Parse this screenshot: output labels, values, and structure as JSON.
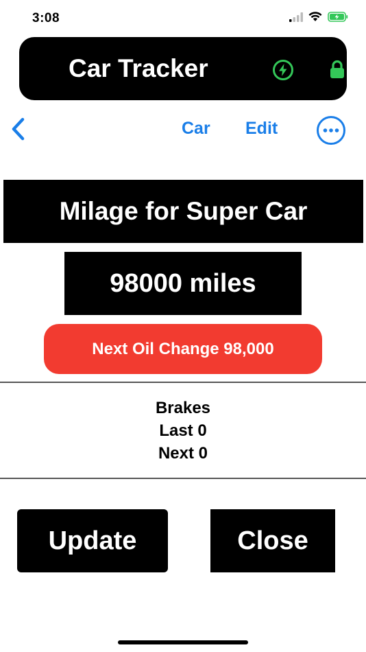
{
  "status_bar": {
    "time": "3:08"
  },
  "app": {
    "title": "Car Tracker"
  },
  "nav": {
    "car_label": "Car",
    "edit_label": "Edit"
  },
  "mileage": {
    "title": "Milage for Super Car",
    "value": "98000 miles",
    "next_oil_change": "Next Oil Change 98,000"
  },
  "brakes": {
    "label": "Brakes",
    "last": "Last 0",
    "next": "Next 0"
  },
  "actions": {
    "update_label": "Update",
    "close_label": "Close"
  },
  "colors": {
    "accent": "#1a7ee8",
    "alert": "#f23b30",
    "secure": "#34c759"
  },
  "icons": [
    "back-chevron-icon",
    "more-options-icon",
    "charging-bolt-icon",
    "lock-icon",
    "signal-icon",
    "wifi-icon",
    "battery-icon"
  ]
}
